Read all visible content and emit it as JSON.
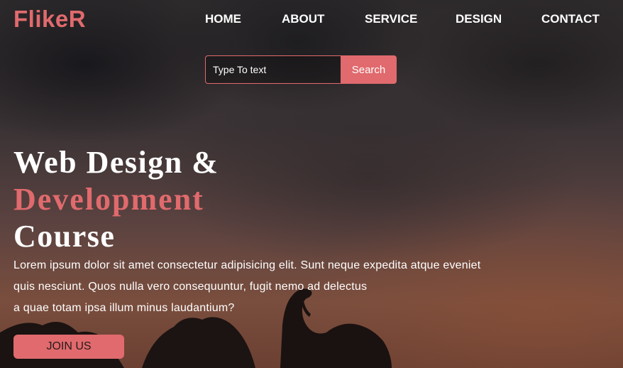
{
  "brand": {
    "name": "FlikeR",
    "accent_color": "#e06a6d"
  },
  "nav": {
    "items": [
      {
        "label": "HOME"
      },
      {
        "label": "ABOUT"
      },
      {
        "label": "SERVICE"
      },
      {
        "label": "DESIGN"
      },
      {
        "label": "CONTACT"
      }
    ]
  },
  "search": {
    "placeholder": "Type To text",
    "button_label": "Search"
  },
  "hero": {
    "headline_line1": "Web Design &",
    "headline_line2": "Development",
    "headline_line3": "Course",
    "description_line1": "Lorem ipsum dolor sit amet consectetur adipisicing elit. Sunt neque expedita atque eveniet",
    "description_line2": "quis nesciunt. Quos nulla vero consequuntur, fugit nemo ad delectus",
    "description_line3": "a quae totam ipsa illum minus laudantium?",
    "cta_label": "JOIN US"
  }
}
